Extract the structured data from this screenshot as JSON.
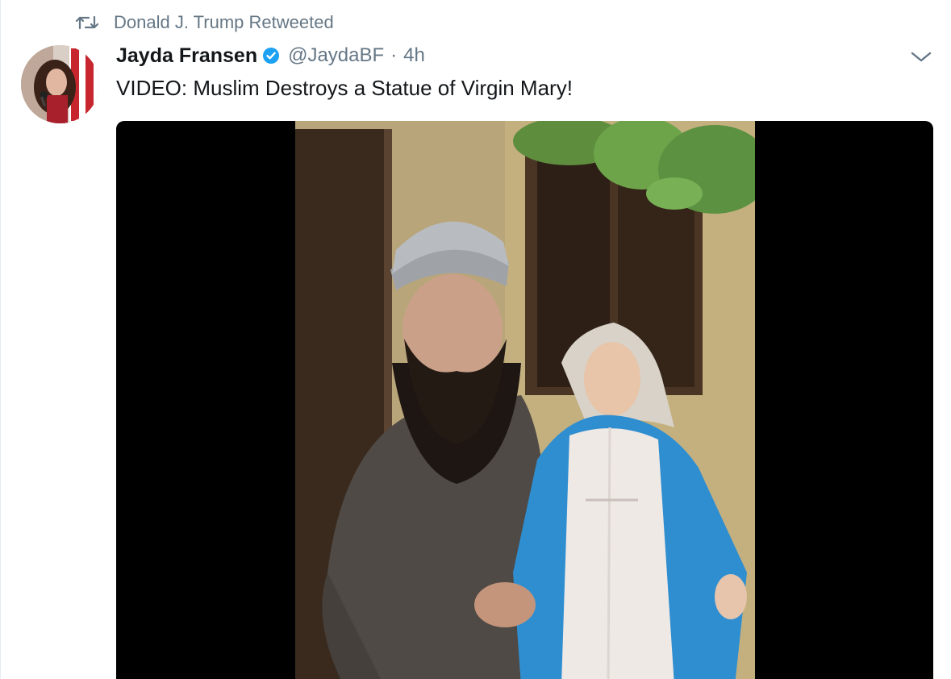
{
  "retweet": {
    "icon": "retweet-icon",
    "text": "Donald J. Trump Retweeted"
  },
  "author": {
    "name": "Jayda Fransen",
    "handle": "@JaydaBF",
    "separator": "·",
    "time": "4h",
    "verified_icon": "verified-badge-icon",
    "avatar_icon": "avatar"
  },
  "tweet": {
    "text": "VIDEO: Muslim Destroys a Statue of Virgin Mary!"
  },
  "menu": {
    "icon": "chevron-down-icon"
  },
  "media": {
    "type": "video",
    "content": "video-thumbnail"
  },
  "colors": {
    "text_primary": "#14171a",
    "text_secondary": "#657786",
    "verified_blue": "#1da1f2",
    "media_background": "#000000"
  }
}
